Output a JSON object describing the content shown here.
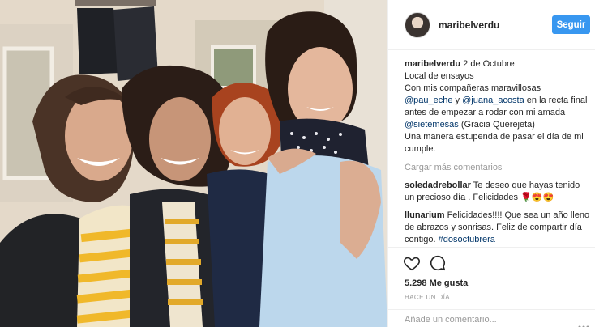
{
  "post": {
    "username": "maribelverdu",
    "follow_label": "Seguir",
    "caption": {
      "author": "maribelverdu",
      "date": "2 de Octubre",
      "line1": "Local de ensayos",
      "line2_a": "Con mis compañeras maravillosas",
      "mention1": "@pau_eche",
      "conj": " y ",
      "mention2": "@juana_acosta",
      "line2_b": " en la recta final antes de empezar a rodar con mi amada ",
      "mention3": "@sietemesas",
      "line2_c": " (Gracia Querejeta)",
      "line3": "Una manera estupenda de pasar el día de mi cumple."
    },
    "load_more_label": "Cargar más comentarios",
    "comments": [
      {
        "user": "soledadrebollar",
        "text": " Te deseo que hayas tenido un precioso día . Felicidades 🌹😍😍"
      },
      {
        "user": "llunarium",
        "text": " Felicidades!!!! Que sea un año lleno de abrazos y sonrisas. Feliz de compartir día contigo. ",
        "tag": "#dosoctubrera"
      }
    ],
    "likes": "5.298 Me gusta",
    "time_ago": "HACE UN DÍA",
    "add_comment_placeholder": "Añade un comentario...",
    "icons": {
      "like": "heart-icon",
      "comment": "comment-bubble-icon",
      "more": "ellipsis-icon"
    },
    "colors": {
      "accent": "#3897f0",
      "mention": "#003569",
      "muted": "#999999"
    }
  }
}
